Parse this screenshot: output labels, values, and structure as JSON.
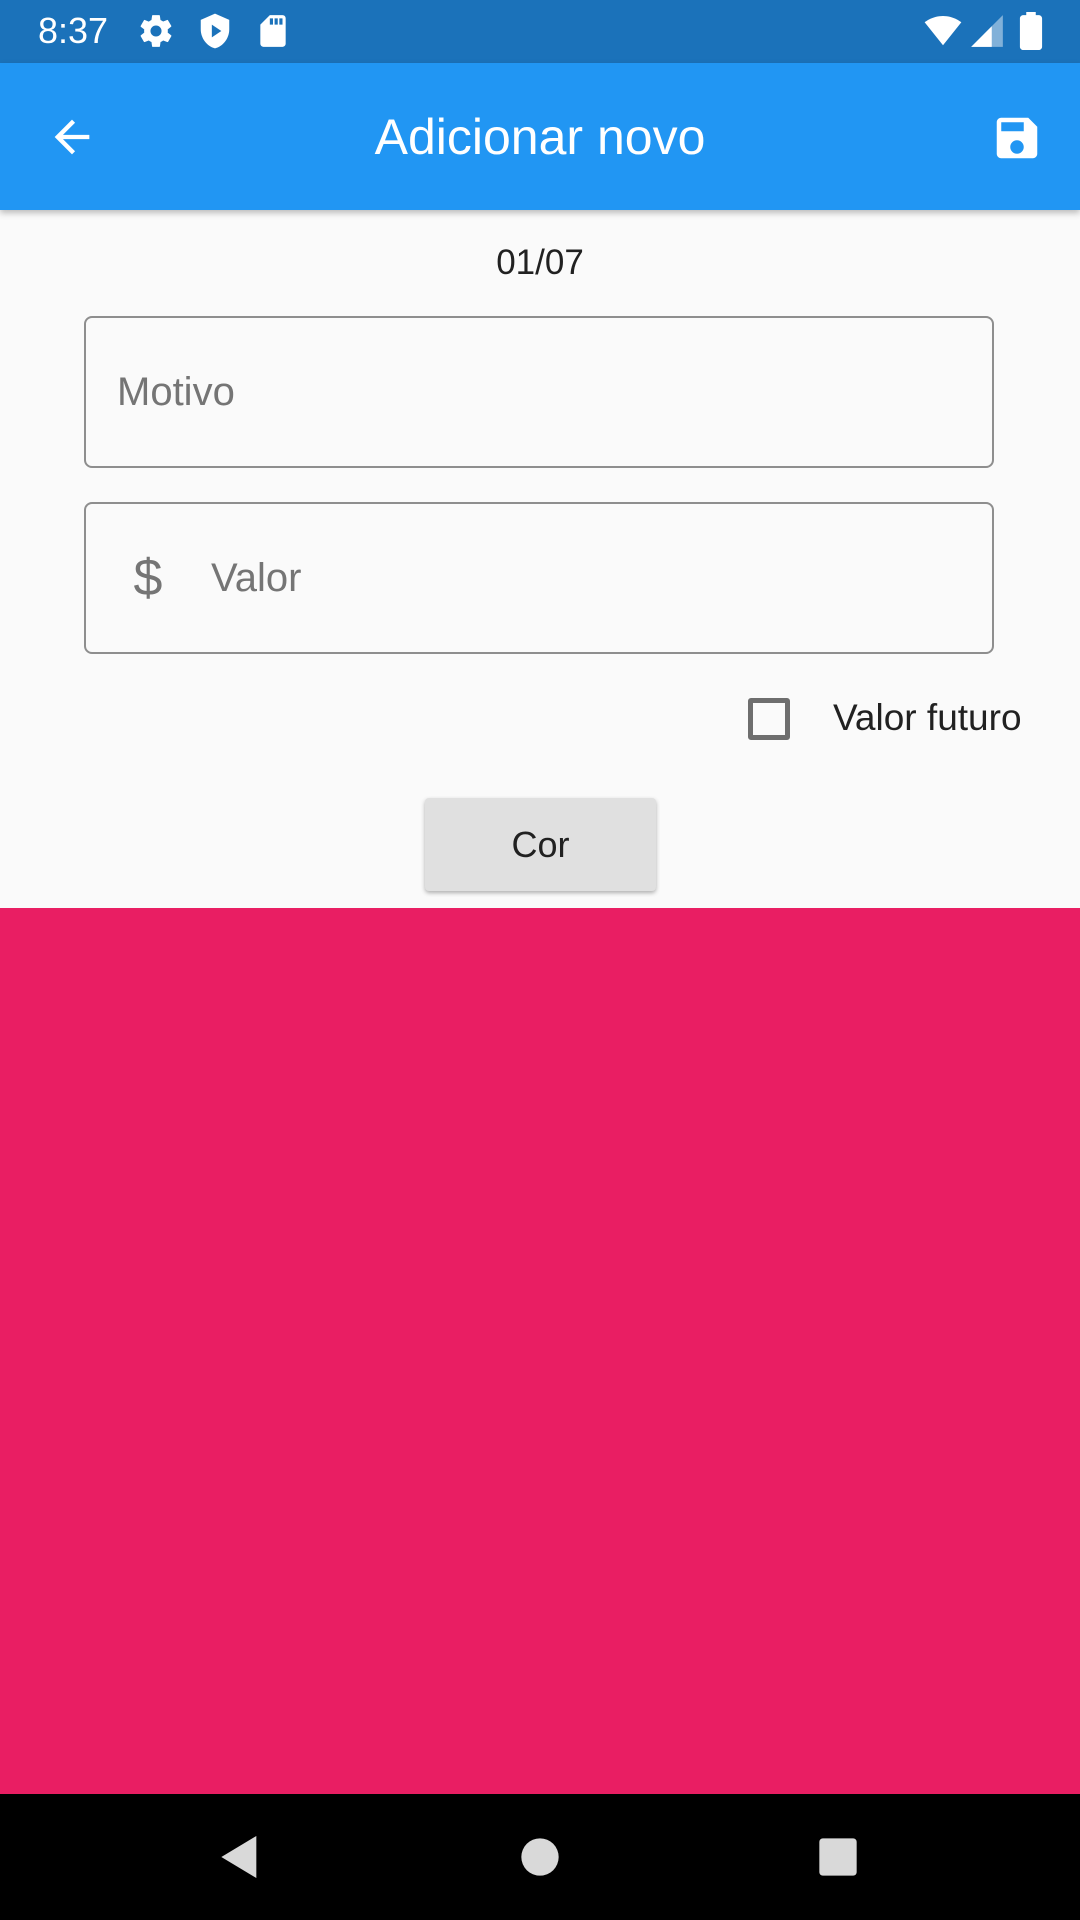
{
  "status_bar": {
    "time": "8:37",
    "icons": [
      "settings-icon",
      "shield-play-icon",
      "sd-card-icon",
      "wifi-icon",
      "cell-signal-icon",
      "battery-icon"
    ]
  },
  "app_bar": {
    "title": "Adicionar novo",
    "back_icon": "arrow-back-icon",
    "save_icon": "save-icon"
  },
  "form": {
    "date": "01/07",
    "motivo_placeholder": "Motivo",
    "motivo_value": "",
    "valor_placeholder": "Valor",
    "valor_value": "",
    "valor_prefix": "$",
    "future_value_label": "Valor futuro",
    "future_value_checked": false,
    "color_button_label": "Cor"
  },
  "selected_color": "#e91e63",
  "colors": {
    "status_bar": "#1b72ba",
    "app_bar": "#2196f3",
    "background": "#fafafa",
    "nav_bar": "#000000"
  },
  "nav_bar": {
    "buttons": [
      "back-triangle-icon",
      "home-circle-icon",
      "recents-square-icon"
    ]
  }
}
